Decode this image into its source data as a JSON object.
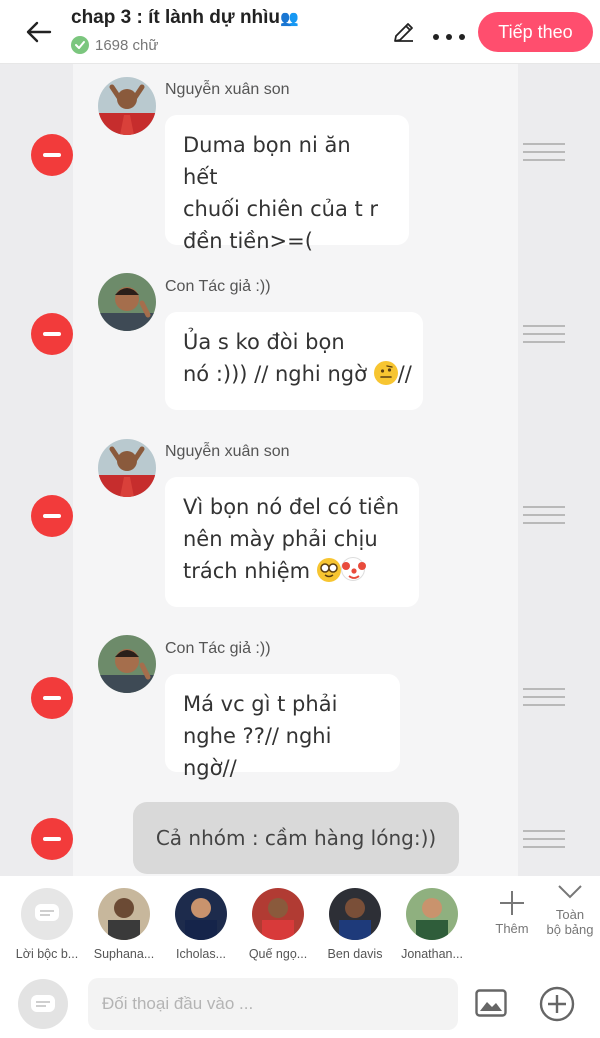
{
  "header": {
    "title": "chap 3 : ít lành dự nhìu",
    "title_emoji": "👥",
    "word_count": "1698 chữ",
    "next_label": "Tiếp theo"
  },
  "messages": [
    {
      "speaker": "Nguyễn xuân son",
      "lines": [
        "Duma bọn ni ăn hết",
        "chuối chiên của t r",
        "đền tiền>=("
      ]
    },
    {
      "speaker": "Con Tác giả :))",
      "lines": [
        "Ủa s ko đòi bọn",
        "nó :))) // nghi ngờ"
      ],
      "line2_suffix": "//"
    },
    {
      "speaker": "Nguyễn xuân son",
      "lines": [
        "Vì bọn nó đel có tiền",
        "nên mày phải chịu",
        "trách nhiệm"
      ]
    },
    {
      "speaker": "Con Tác giả :))",
      "lines": [
        "Má vc gì t phải",
        "nghe ??// nghi ngờ//"
      ]
    }
  ],
  "narration": "Cả nhóm : cầm hàng lóng:))",
  "characters": [
    {
      "label": "Lời bộc b..."
    },
    {
      "label": "Suphana..."
    },
    {
      "label": "Icholas..."
    },
    {
      "label": "Quế ngọ..."
    },
    {
      "label": "Ben davis"
    },
    {
      "label": "Jonathan..."
    }
  ],
  "tools": {
    "add": "Thêm",
    "all_line1": "Toàn",
    "all_line2": "bộ bảng"
  },
  "input": {
    "placeholder": "Đối thoại đầu vào ..."
  },
  "colors": {
    "accent": "#ff4e6e",
    "remove": "#f23b3b",
    "check": "#7bc67e"
  }
}
